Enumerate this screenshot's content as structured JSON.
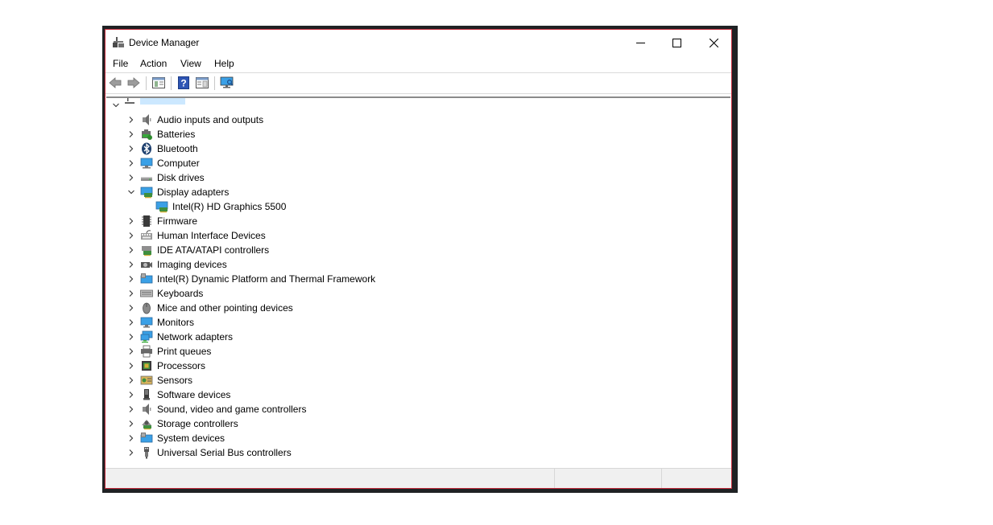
{
  "window": {
    "title": "Device Manager",
    "border_color": "#c32a3a",
    "controls": [
      "minimize-icon",
      "maximize-icon",
      "close-icon"
    ]
  },
  "menu": [
    "File",
    "Action",
    "View",
    "Help"
  ],
  "toolbar": [
    "back-arrow-icon",
    "forward-arrow-icon",
    "properties-pane-icon",
    "help-icon",
    "update-driver-icon",
    "scan-hardware-icon"
  ],
  "tree": {
    "root_label": "",
    "categories": [
      {
        "label": "Audio inputs and outputs",
        "icon": "speaker-icon",
        "expanded": false
      },
      {
        "label": "Batteries",
        "icon": "battery-icon",
        "expanded": false
      },
      {
        "label": "Bluetooth",
        "icon": "bluetooth-icon",
        "expanded": false
      },
      {
        "label": "Computer",
        "icon": "computer-icon",
        "expanded": false
      },
      {
        "label": "Disk drives",
        "icon": "disk-drive-icon",
        "expanded": false
      },
      {
        "label": "Display adapters",
        "icon": "display-adapter-icon",
        "expanded": true,
        "children": [
          {
            "label": "Intel(R) HD Graphics 5500",
            "icon": "display-adapter-icon"
          }
        ]
      },
      {
        "label": "Firmware",
        "icon": "firmware-icon",
        "expanded": false
      },
      {
        "label": "Human Interface Devices",
        "icon": "hid-icon",
        "expanded": false
      },
      {
        "label": "IDE ATA/ATAPI controllers",
        "icon": "ide-controller-icon",
        "expanded": false
      },
      {
        "label": "Imaging devices",
        "icon": "camera-icon",
        "expanded": false
      },
      {
        "label": "Intel(R) Dynamic Platform and Thermal Framework",
        "icon": "system-device-icon",
        "expanded": false
      },
      {
        "label": "Keyboards",
        "icon": "keyboard-icon",
        "expanded": false
      },
      {
        "label": "Mice and other pointing devices",
        "icon": "mouse-icon",
        "expanded": false
      },
      {
        "label": "Monitors",
        "icon": "monitor-icon",
        "expanded": false
      },
      {
        "label": "Network adapters",
        "icon": "network-adapter-icon",
        "expanded": false
      },
      {
        "label": "Print queues",
        "icon": "printer-icon",
        "expanded": false
      },
      {
        "label": "Processors",
        "icon": "processor-icon",
        "expanded": false
      },
      {
        "label": "Sensors",
        "icon": "sensor-icon",
        "expanded": false
      },
      {
        "label": "Software devices",
        "icon": "software-device-icon",
        "expanded": false
      },
      {
        "label": "Sound, video and game controllers",
        "icon": "speaker-icon",
        "expanded": false
      },
      {
        "label": "Storage controllers",
        "icon": "storage-controller-icon",
        "expanded": false
      },
      {
        "label": "System devices",
        "icon": "system-device-icon",
        "expanded": false
      },
      {
        "label": "Universal Serial Bus controllers",
        "icon": "usb-icon",
        "expanded": false
      }
    ]
  },
  "statusbar": {
    "sections": [
      "",
      "",
      ""
    ]
  }
}
